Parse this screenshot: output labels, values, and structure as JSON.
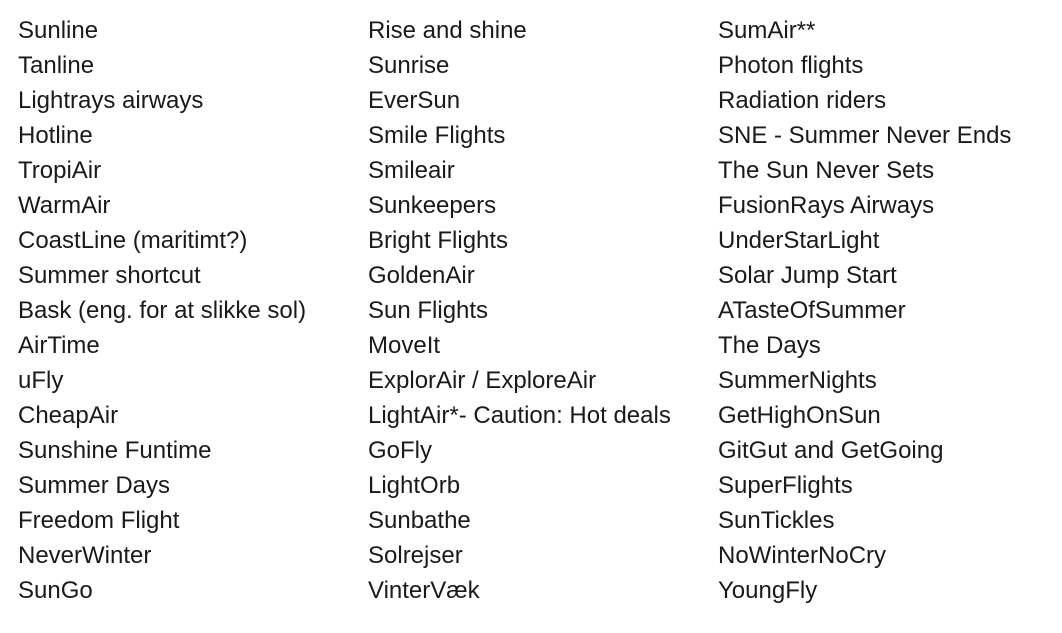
{
  "columns": [
    {
      "names": [
        "Sunline",
        "Tanline",
        "Lightrays airways",
        "Hotline",
        "TropiAir",
        "WarmAir",
        "CoastLine (maritimt?)",
        "Summer shortcut",
        "Bask (eng. for at slikke sol)",
        "AirTime",
        "uFly",
        "CheapAir",
        "Sunshine Funtime",
        "Summer Days",
        "Freedom Flight",
        "NeverWinter",
        "SunGo"
      ]
    },
    {
      "names": [
        "Rise and shine",
        "Sunrise",
        "EverSun",
        "Smile Flights",
        "Smileair",
        "Sunkeepers",
        "Bright Flights",
        "GoldenAir",
        "Sun Flights",
        "MoveIt",
        "ExplorAir / ExploreAir",
        "LightAir*- Caution: Hot deals",
        "GoFly",
        "LightOrb",
        "Sunbathe",
        "Solrejser",
        "VinterVæk"
      ]
    },
    {
      "names": [
        "SumAir**",
        "Photon flights",
        "Radiation riders",
        "SNE - Summer Never Ends",
        "The Sun Never Sets",
        "FusionRays Airways",
        "UnderStarLight",
        "Solar Jump Start",
        "ATasteOfSummer",
        "The Days",
        "SummerNights",
        "GetHighOnSun",
        "GitGut and GetGoing",
        "SuperFlights",
        "SunTickles",
        "NoWinterNoCry",
        "YoungFly"
      ]
    }
  ]
}
